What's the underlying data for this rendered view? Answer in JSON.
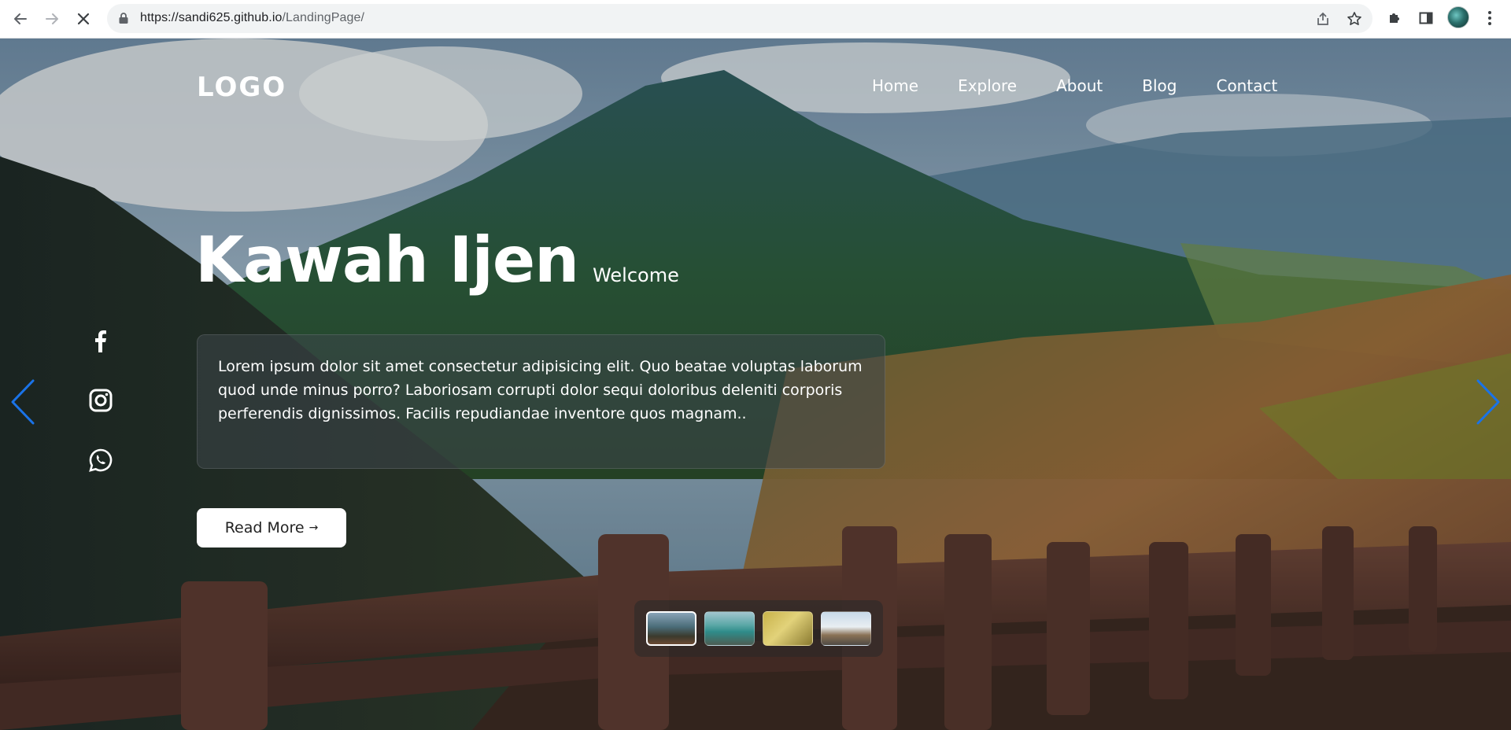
{
  "browser": {
    "url_host": "https://sandi625.github.io",
    "url_path": "/LandingPage/",
    "icons": [
      "back-arrow-icon",
      "forward-arrow-icon",
      "stop-loading-icon",
      "lock-icon",
      "share-icon",
      "star-icon",
      "extensions-icon",
      "sidepanel-icon",
      "profile-avatar",
      "kebab-menu-icon"
    ]
  },
  "header": {
    "logo": "LOGO",
    "nav": [
      "Home",
      "Explore",
      "About",
      "Blog",
      "Contact"
    ]
  },
  "hero": {
    "title": "Kawah Ijen",
    "subtitle": "Welcome",
    "description": "Lorem ipsum dolor sit amet consectetur adipisicing elit. Quo beatae voluptas laborum quod unde minus porro? Laboriosam corrupti dolor sequi doloribus deleniti corporis perferendis dignissimos. Facilis repudiandae inventore quos magnam..",
    "button_label": "Read More",
    "button_arrow": "→"
  },
  "social": [
    "facebook-icon",
    "instagram-icon",
    "whatsapp-icon"
  ],
  "slider": {
    "thumbnail_count": 4,
    "active_index": 0,
    "arrow_color": "#1a73e8"
  }
}
